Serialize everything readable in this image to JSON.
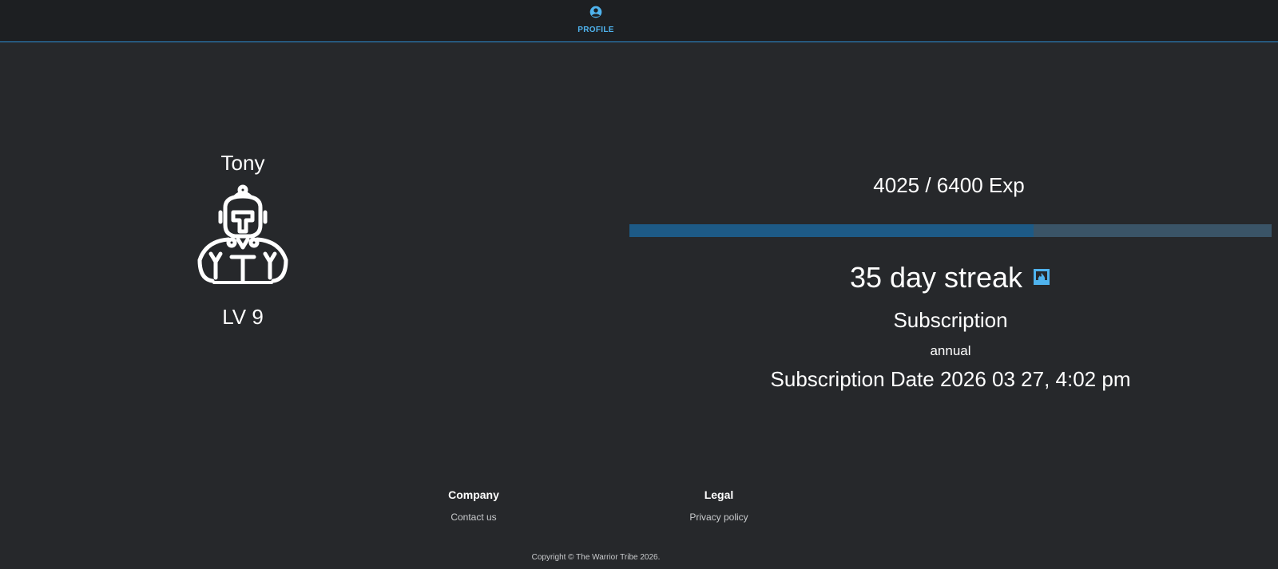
{
  "nav": {
    "tabs": [
      {
        "label": "PROFILE",
        "icon": "account-circle-icon",
        "active": true
      }
    ]
  },
  "profile": {
    "name": "Tony",
    "avatar_icon": "spartan-warrior-icon",
    "level_label": "LV 9"
  },
  "stats": {
    "exp_text": "4025 / 6400 Exp",
    "exp_current": 4025,
    "exp_max": 6400,
    "streak_text": "35 day streak",
    "streak_icon": "fireplace-icon",
    "subscription_title": "Subscription",
    "subscription_plan": "annual",
    "subscription_date": "Subscription Date 2026 03 27, 4:02 pm"
  },
  "footer": {
    "company_heading": "Company",
    "contact_link": "Contact us",
    "legal_heading": "Legal",
    "privacy_link": "Privacy policy",
    "copyright": "Copyright © The Warrior Tribe 2026."
  },
  "colors": {
    "accent": "#4fb3ee",
    "progress_fill": "#1d5a86",
    "progress_track": "#3a5467",
    "background": "#26282b",
    "topbar": "#1d1f22"
  }
}
